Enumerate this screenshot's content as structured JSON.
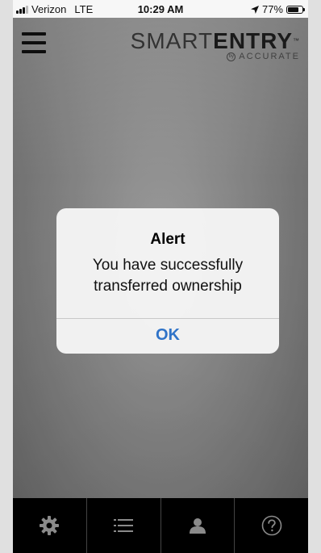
{
  "status_bar": {
    "carrier": "Verizon",
    "network": "LTE",
    "time": "10:29 AM",
    "battery": "77%",
    "battery_level": 0.77
  },
  "header": {
    "logo_thin": "SMART",
    "logo_bold": "ENTRY",
    "logo_tm": "™",
    "logo_sub": "ACCURATE",
    "logo_badge": "by",
    "menu_icon": "hamburger-menu-icon"
  },
  "alert": {
    "title": "Alert",
    "message": "You have successfully transferred ownership",
    "ok_label": "OK",
    "accent": "#2f73c8"
  },
  "tabbar": {
    "items": [
      {
        "icon": "gear-icon"
      },
      {
        "icon": "list-icon"
      },
      {
        "icon": "person-icon"
      },
      {
        "icon": "help-icon"
      }
    ],
    "icon_color": "#8a8a8a"
  }
}
